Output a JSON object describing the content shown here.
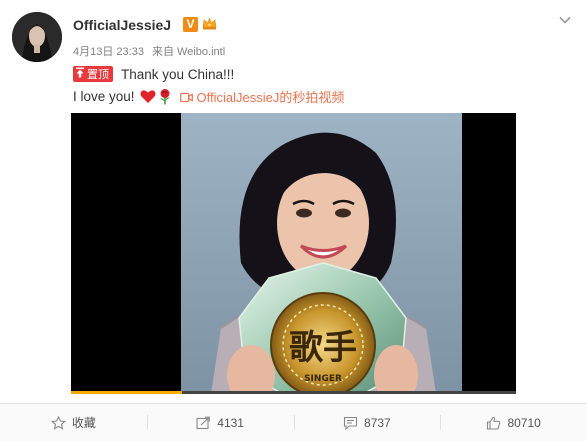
{
  "post": {
    "username": "OfficialJessieJ",
    "verified_badge": "V",
    "date": "4月13日 23:33",
    "source": "来自 Weibo.intl",
    "pinned_label": "置顶",
    "text_line1": "Thank you China!!!",
    "text_line2": "I love you!",
    "emoji": [
      "heart-emoji",
      "rose-emoji"
    ],
    "video_link": "OfficialJessieJ的秒拍视频",
    "video_overlay_text": "歌手",
    "video_overlay_subtext": "SINGER",
    "video_progress_percent": 25
  },
  "actions": {
    "favorite_label": "收藏",
    "repost_count": "4131",
    "comment_count": "8737",
    "like_count": "80710"
  },
  "colors": {
    "link": "#eb7350",
    "pinned_badge": "#e8393c",
    "verified": "#f08c15",
    "progress": "#f7ab00"
  },
  "icons": [
    "chevron-down-icon",
    "star-icon",
    "repost-icon",
    "comment-icon",
    "like-icon",
    "video-camera-icon",
    "pin-icon",
    "vip-crown-icon"
  ]
}
